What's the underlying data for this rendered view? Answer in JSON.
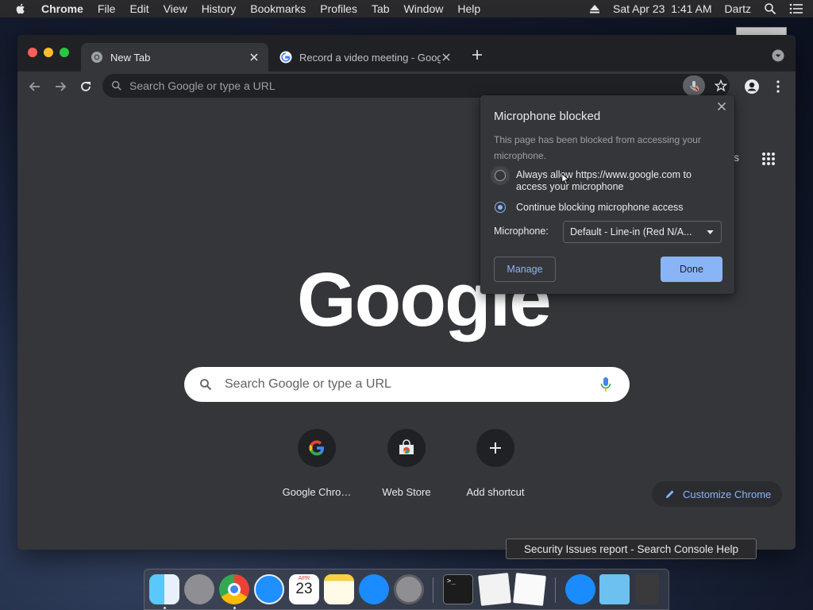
{
  "menubar": {
    "app_name": "Chrome",
    "items": [
      "File",
      "Edit",
      "View",
      "History",
      "Bookmarks",
      "Profiles",
      "Tab",
      "Window",
      "Help"
    ],
    "datetime": "Sat Apr 23  1:41 AM",
    "user": "Dartz"
  },
  "tabs": [
    {
      "title": "New Tab",
      "active": true
    },
    {
      "title": "Record a video meeting - Goog",
      "active": false
    }
  ],
  "omnibox": {
    "placeholder": "Search Google or type a URL"
  },
  "ntp": {
    "logo_text": "Google",
    "search_placeholder": "Search Google or type a URL",
    "shortcuts": [
      {
        "label": "Google Chro…",
        "icon": "google-icon"
      },
      {
        "label": "Web Store",
        "icon": "web-store-icon"
      },
      {
        "label": "Add shortcut",
        "icon": "plus-icon"
      }
    ],
    "customize_label": "Customize Chrome",
    "apps_partial_label": "s"
  },
  "popup": {
    "title": "Microphone blocked",
    "description": "This page has been blocked from accessing your microphone.",
    "option_allow": "Always allow https://www.google.com to access your microphone",
    "option_block": "Continue blocking microphone access",
    "selected_option": "block",
    "microphone_label": "Microphone:",
    "microphone_value": "Default - Line-in (Red N/A...",
    "manage_label": "Manage",
    "done_label": "Done"
  },
  "tooltip": {
    "text": "Security Issues report - Search Console Help"
  },
  "dock": {
    "apps": [
      "Finder",
      "Launchpad",
      "Google Chrome",
      "Safari",
      "Calendar",
      "Notes",
      "App Store",
      "System Preferences",
      "Terminal",
      "Preview",
      "TextEdit",
      "App Store",
      "Downloads",
      "Trash"
    ],
    "calendar_month": "APR",
    "calendar_day": "23"
  },
  "colors": {
    "accent": "#8ab4f8",
    "window_bg": "#35363a",
    "tabstrip_bg": "#202124",
    "close": "#ff5f57",
    "minimize": "#febc2e",
    "zoom": "#28c840"
  }
}
